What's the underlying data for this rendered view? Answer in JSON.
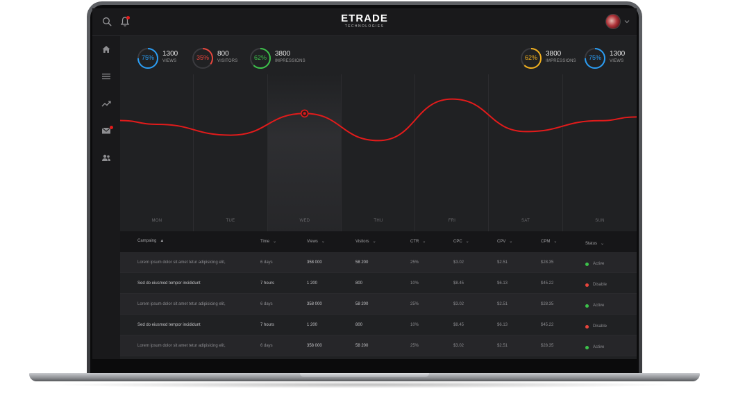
{
  "header": {
    "logo_main": "ETRADE",
    "logo_sub": "TECHNOLOGIES"
  },
  "colors": {
    "accent_red": "#e21b1b",
    "blue": "#2a9df4",
    "orange_red": "#e8453c",
    "green": "#3cc24a",
    "yellow": "#f2b01e",
    "active_status": "#3cc24a",
    "disable_status": "#e8453c"
  },
  "icons": {
    "top": [
      "search-icon",
      "bell-icon",
      "chevron-down-icon"
    ],
    "sidebar": [
      "home-icon",
      "menu-icon",
      "trend-icon",
      "mail-icon",
      "users-icon"
    ]
  },
  "stats_left": [
    {
      "percent": "75%",
      "fraction": 0.75,
      "color": "#2a9df4",
      "value": "1300",
      "caption": "VIEWS"
    },
    {
      "percent": "35%",
      "fraction": 0.35,
      "color": "#e8453c",
      "value": "800",
      "caption": "VISITORS"
    },
    {
      "percent": "62%",
      "fraction": 0.62,
      "color": "#3cc24a",
      "value": "3800",
      "caption": "IMPRESSIONS"
    }
  ],
  "stats_right": [
    {
      "percent": "62%",
      "fraction": 0.62,
      "color": "#f2b01e",
      "value": "3800",
      "caption": "IMPRESSIONS"
    },
    {
      "percent": "75%",
      "fraction": 0.75,
      "color": "#2a9df4",
      "value": "1300",
      "caption": "VIEWS"
    }
  ],
  "chart_data": {
    "type": "line",
    "categories": [
      "MON",
      "TUE",
      "WED",
      "THU",
      "FRI",
      "SAT",
      "SUN"
    ],
    "highlighted_category": "WED",
    "grid": false,
    "series": [
      {
        "values": [
          60,
          48,
          72,
          42,
          88,
          52,
          64
        ]
      }
    ]
  },
  "table": {
    "headers": [
      "Campaing",
      "Time",
      "Views",
      "Visitors",
      "CTR",
      "CPC",
      "CPV",
      "CPM",
      "Status"
    ],
    "sort_indicator": "▲",
    "rows": [
      [
        "Lorem ipsum dolor sit amet tetur adipisicing elit,",
        "6 days",
        "358 000",
        "58 200",
        "25%",
        "$3.02",
        "$2.51",
        "$28.35",
        "Active"
      ],
      [
        "Sed do eiusmod tempor incididunt",
        "7 hours",
        "1 200",
        "800",
        "10%",
        "$8.45",
        "$6.13",
        "$45.22",
        "Disable"
      ],
      [
        "Lorem ipsum dolor sit amet tetur adipisicing elit,",
        "6 days",
        "358 000",
        "58 200",
        "25%",
        "$3.02",
        "$2.51",
        "$28.35",
        "Active"
      ],
      [
        "Sed do eiusmod tempor incididunt",
        "7 hours",
        "1 200",
        "800",
        "10%",
        "$8.45",
        "$6.13",
        "$45.22",
        "Disable"
      ],
      [
        "Lorem ipsum dolor sit amet tetur adipisicing elit,",
        "6 days",
        "358 000",
        "58 200",
        "25%",
        "$3.02",
        "$2.51",
        "$28.35",
        "Active"
      ]
    ]
  }
}
